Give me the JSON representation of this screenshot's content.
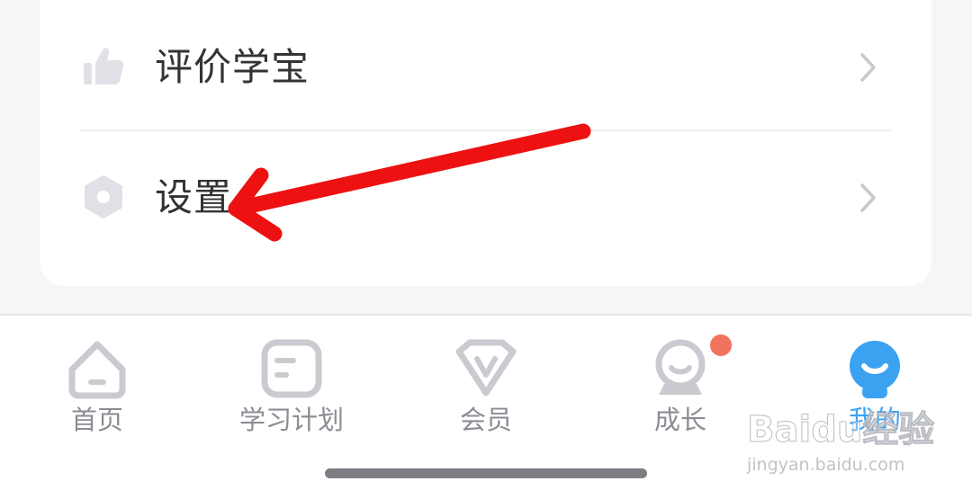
{
  "menu": {
    "items": [
      {
        "label": "评价学宝",
        "icon": "thumbs-up-icon"
      },
      {
        "label": "设置",
        "icon": "settings-hexagon-icon"
      }
    ]
  },
  "tabbar": {
    "tabs": [
      {
        "label": "首页",
        "icon": "home-icon",
        "active": false
      },
      {
        "label": "学习计划",
        "icon": "study-plan-icon",
        "active": false
      },
      {
        "label": "会员",
        "icon": "vip-icon",
        "active": false
      },
      {
        "label": "成长",
        "icon": "growth-icon",
        "active": false,
        "has_badge": true
      },
      {
        "label": "我的",
        "icon": "profile-icon",
        "active": true
      }
    ]
  },
  "watermark": {
    "logo": "Baidu经验",
    "url": "jingyan.baidu.com"
  },
  "colors": {
    "active_tab": "#3ba2f2",
    "inactive_tab": "#8a8d93",
    "badge": "#f2735d",
    "annotation_arrow": "#ee1111"
  }
}
